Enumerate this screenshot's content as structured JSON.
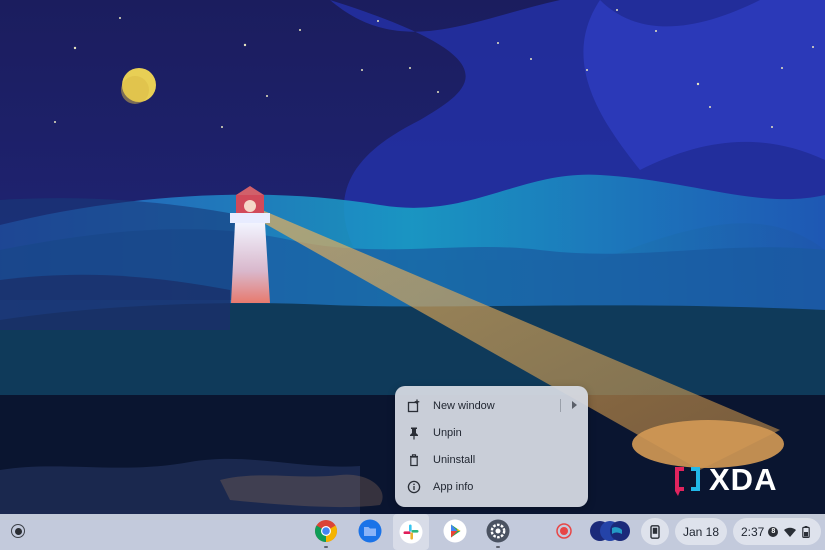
{
  "context_menu": {
    "items": [
      {
        "label": "New window",
        "icon": "new-window-icon",
        "has_submenu": true
      },
      {
        "label": "Unpin",
        "icon": "pin-icon"
      },
      {
        "label": "Uninstall",
        "icon": "trash-icon"
      },
      {
        "label": "App info",
        "icon": "info-icon"
      }
    ]
  },
  "watermark": {
    "text": "XDA",
    "accent_colors": [
      "#e0245e",
      "#22b8e8"
    ]
  },
  "shelf": {
    "launcher_icon": "launcher-icon",
    "apps": [
      {
        "name": "Chrome",
        "icon": "chrome-icon"
      },
      {
        "name": "Files",
        "icon": "files-icon"
      },
      {
        "name": "Slack",
        "icon": "slack-icon"
      },
      {
        "name": "Play Store",
        "icon": "play-store-icon"
      },
      {
        "name": "Settings",
        "icon": "settings-icon"
      }
    ],
    "tray": {
      "screen_record_icon": "screen-record-icon",
      "holding_space_icon": "holding-space-icon",
      "phone_hub_icon": "phone-icon",
      "date": "Jan 18",
      "time": "2:37",
      "notification_count": "8",
      "wifi_icon": "wifi-icon",
      "battery_icon": "battery-icon"
    }
  },
  "colors": {
    "sky": "#1a1f6b",
    "menu_bg": "#d6dae2",
    "shelf_bg": "#d0d6e2",
    "record_red": "#e84545"
  }
}
